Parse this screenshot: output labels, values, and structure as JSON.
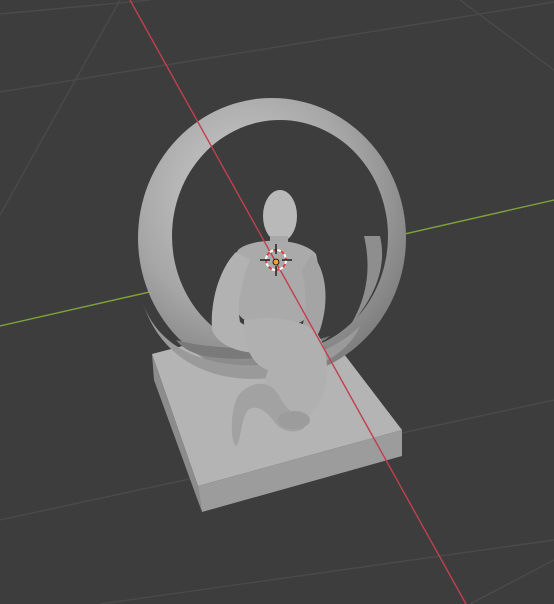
{
  "viewport": {
    "background": "#3d3d3d",
    "grid_color": "#4a4a4a",
    "x_axis_color": "#c0404f",
    "y_axis_color": "#7ea23a",
    "object_color": "#a8a8a8",
    "object_shadow": "#7e7e7e",
    "object_highlight": "#c8c8c8",
    "cursor_icon": "3d-cursor-icon",
    "origin_icon": "object-origin-icon"
  }
}
